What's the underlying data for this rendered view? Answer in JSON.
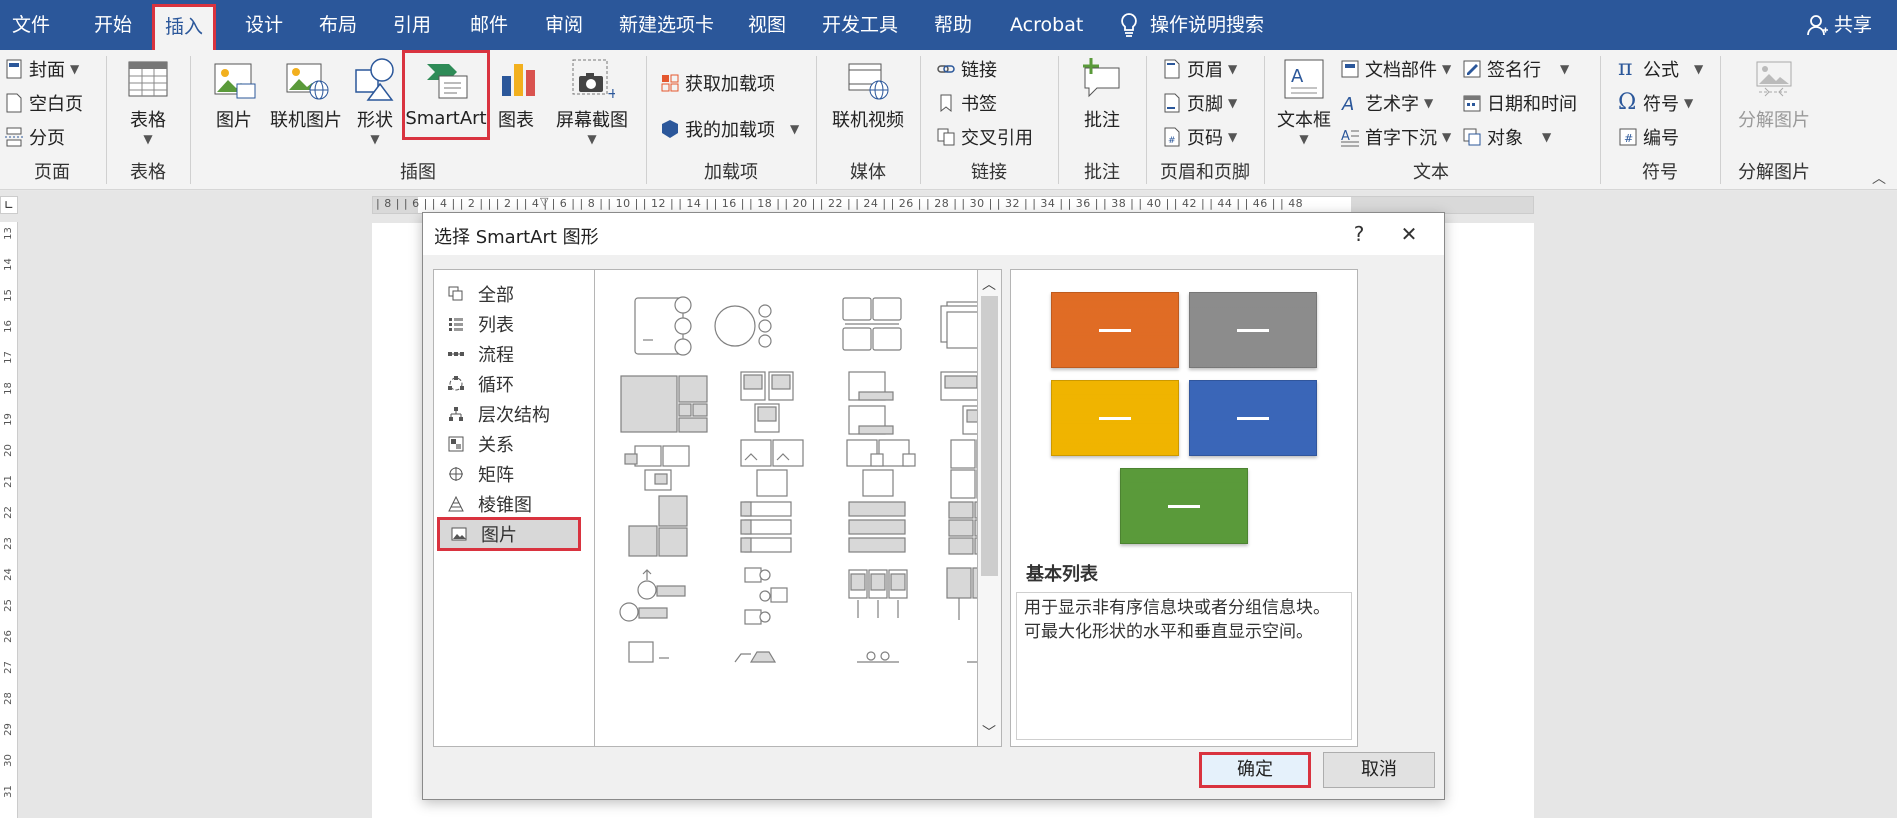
{
  "menubar": {
    "tabs": [
      "文件",
      "开始",
      "插入",
      "设计",
      "布局",
      "引用",
      "邮件",
      "审阅",
      "新建选项卡",
      "视图",
      "开发工具",
      "帮助",
      "Acrobat"
    ],
    "active_tab": "插入",
    "tell_me": "操作说明搜索",
    "share": "共享"
  },
  "ribbon": {
    "pages": {
      "items": [
        "封面",
        "空白页",
        "分页"
      ],
      "label": "页面"
    },
    "tables": {
      "button": "表格",
      "label": "表格"
    },
    "illustrations": {
      "buttons": [
        "图片",
        "联机图片",
        "形状",
        "SmartArt",
        "图表",
        "屏幕截图"
      ],
      "label": "插图"
    },
    "addins": {
      "items": [
        "获取加载项",
        "我的加载项"
      ],
      "label": "加载项"
    },
    "media": {
      "button": "联机视频",
      "label": "媒体"
    },
    "links": {
      "items": [
        "链接",
        "书签",
        "交叉引用"
      ],
      "label": "链接"
    },
    "comments": {
      "button": "批注",
      "label": "批注"
    },
    "headerfooter": {
      "items": [
        "页眉",
        "页脚",
        "页码"
      ],
      "label": "页眉和页脚"
    },
    "text": {
      "textbox": "文本框",
      "items_col1": [
        "文档部件",
        "艺术字",
        "首字下沉"
      ],
      "items_col2": [
        "签名行",
        "日期和时间",
        "对象"
      ],
      "label": "文本"
    },
    "symbols": {
      "items": [
        "公式",
        "符号",
        "编号"
      ],
      "label": "符号"
    },
    "decompose": {
      "button": "分解图片",
      "label": "分解图片"
    }
  },
  "ruler": {
    "top_ticks": "| 8 |  | 6 |  | 4 |  | 2 |  |  | 2 |  | 4 |  | 6 |  | 8 |  | 10 |  | 12 |  | 14 |  | 16 |  | 18 |  | 20 |  | 22 |  | 24 |  | 26 |  | 28 |  | 30 |  | 32 |  | 34 |  | 36 |  | 38 |  | 40 |  | 42 |  | 44 |  | 46 |  | 48",
    "left_ticks": [
      "13",
      "14",
      "15",
      "16",
      "17",
      "18",
      "19",
      "20",
      "21",
      "22",
      "23",
      "24",
      "25",
      "26",
      "27",
      "28",
      "29",
      "30",
      "31"
    ]
  },
  "dialog": {
    "title": "选择 SmartArt 图形",
    "help": "?",
    "close": "✕",
    "categories": [
      "全部",
      "列表",
      "流程",
      "循环",
      "层次结构",
      "关系",
      "矩阵",
      "棱锥图",
      "图片"
    ],
    "selected_category": "图片",
    "preview": {
      "swatch_colors": [
        "#e06c25",
        "#8c8c8c",
        "#f0b400",
        "#3a66b8",
        "#5a9a3a"
      ],
      "name": "基本列表",
      "description": "用于显示非有序信息块或者分组信息块。可最大化形状的水平和垂直显示空间。"
    },
    "ok": "确定",
    "cancel": "取消"
  }
}
